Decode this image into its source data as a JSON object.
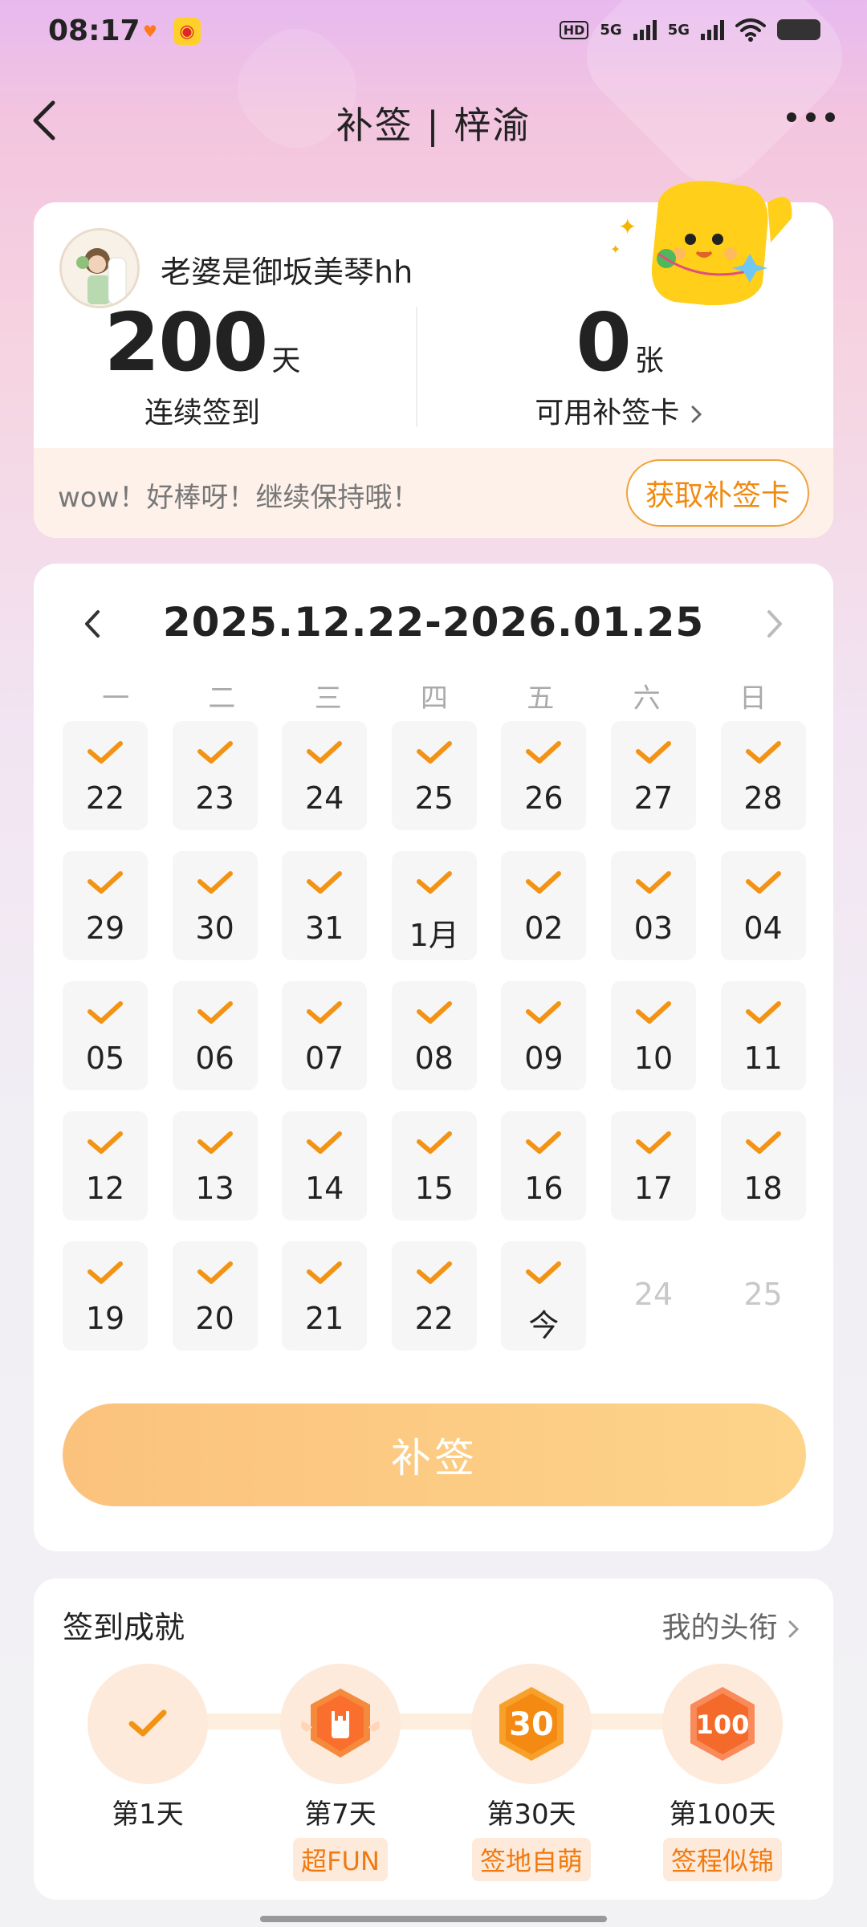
{
  "status_bar": {
    "time": "08:17",
    "network_1": "5G",
    "network_2": "5G",
    "hd_label": "HD"
  },
  "header": {
    "title": "补签 | 梓渝"
  },
  "user": {
    "name": "老婆是御坂美琴hh",
    "streak_value": "200",
    "streak_unit": "天",
    "streak_label": "连续签到",
    "cards_value": "0",
    "cards_unit": "张",
    "cards_label": "可用补签卡",
    "cheer_text": "wow！好棒呀！继续保持哦！",
    "get_card_label": "获取补签卡"
  },
  "calendar": {
    "range": "2025.12.22-2026.01.25",
    "weekdays": [
      "一",
      "二",
      "三",
      "四",
      "五",
      "六",
      "日"
    ],
    "days": [
      {
        "label": "22",
        "checked": true
      },
      {
        "label": "23",
        "checked": true
      },
      {
        "label": "24",
        "checked": true
      },
      {
        "label": "25",
        "checked": true
      },
      {
        "label": "26",
        "checked": true
      },
      {
        "label": "27",
        "checked": true
      },
      {
        "label": "28",
        "checked": true
      },
      {
        "label": "29",
        "checked": true
      },
      {
        "label": "30",
        "checked": true
      },
      {
        "label": "31",
        "checked": true
      },
      {
        "label": "1月",
        "checked": true
      },
      {
        "label": "02",
        "checked": true
      },
      {
        "label": "03",
        "checked": true
      },
      {
        "label": "04",
        "checked": true
      },
      {
        "label": "05",
        "checked": true
      },
      {
        "label": "06",
        "checked": true
      },
      {
        "label": "07",
        "checked": true
      },
      {
        "label": "08",
        "checked": true
      },
      {
        "label": "09",
        "checked": true
      },
      {
        "label": "10",
        "checked": true
      },
      {
        "label": "11",
        "checked": true
      },
      {
        "label": "12",
        "checked": true
      },
      {
        "label": "13",
        "checked": true
      },
      {
        "label": "14",
        "checked": true
      },
      {
        "label": "15",
        "checked": true
      },
      {
        "label": "16",
        "checked": true
      },
      {
        "label": "17",
        "checked": true
      },
      {
        "label": "18",
        "checked": true
      },
      {
        "label": "19",
        "checked": true
      },
      {
        "label": "20",
        "checked": true
      },
      {
        "label": "21",
        "checked": true
      },
      {
        "label": "22",
        "checked": true
      },
      {
        "label": "今",
        "checked": true
      },
      {
        "label": "24",
        "checked": false
      },
      {
        "label": "25",
        "checked": false
      }
    ],
    "resign_label": "补签"
  },
  "achievements": {
    "title": "签到成就",
    "my_titles_label": "我的头衔",
    "items": [
      {
        "day_label": "第1天",
        "tag": "",
        "badge": "check"
      },
      {
        "day_label": "第7天",
        "tag": "超FUN",
        "badge": "hand-icon"
      },
      {
        "day_label": "第30天",
        "tag": "签地自萌",
        "badge": "30"
      },
      {
        "day_label": "第100天",
        "tag": "签程似锦",
        "badge": "100"
      }
    ]
  },
  "colors": {
    "accent": "#f08a10",
    "check": "#f39314",
    "button_gradient_start": "#fbc27d",
    "button_gradient_end": "#fdd48a"
  }
}
